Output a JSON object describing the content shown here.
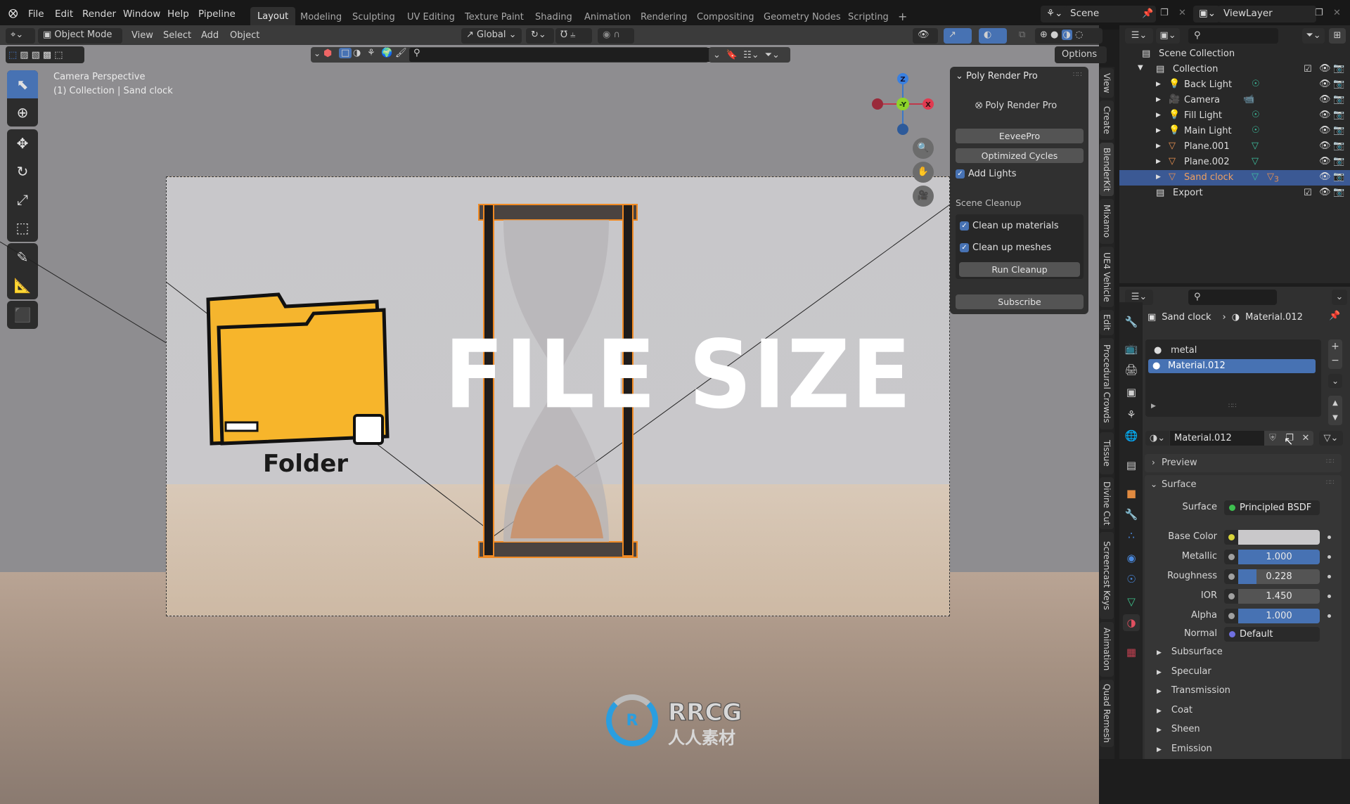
{
  "topbar": {
    "menus": [
      "File",
      "Edit",
      "Render",
      "Window",
      "Help",
      "Pipeline"
    ],
    "workspaces": [
      "Layout",
      "Modeling",
      "Sculpting",
      "UV Editing",
      "Texture Paint",
      "Shading",
      "Animation",
      "Rendering",
      "Compositing",
      "Geometry Nodes",
      "Scripting"
    ],
    "active_workspace": "Layout",
    "add_workspace": "+",
    "scene": "Scene",
    "view_layer": "ViewLayer"
  },
  "viewport_header": {
    "mode": "Object Mode",
    "menus": [
      "View",
      "Select",
      "Add",
      "Object"
    ],
    "orientation": "Global",
    "options": "Options"
  },
  "viewport": {
    "camera_label": "Camera Perspective",
    "collection_label": "(1) Collection | Sand clock",
    "overlay_title": "FILE SIZE",
    "folder_caption": "Folder",
    "watermark_top": "RRCG",
    "watermark_bottom": "人人素材",
    "gizmo": {
      "z": "Z",
      "y": "-Y",
      "x": "X"
    }
  },
  "poly_render_panel": {
    "title": "Poly Render Pro",
    "logo_text": "Poly Render Pro",
    "btn_eevee": "EeveePro",
    "btn_cycles": "Optimized Cycles",
    "add_lights": {
      "label": "Add Lights",
      "checked": true
    },
    "cleanup_heading": "Scene Cleanup",
    "clean_materials": {
      "label": "Clean up materials",
      "checked": true
    },
    "clean_meshes": {
      "label": "Clean up meshes",
      "checked": true
    },
    "btn_run_cleanup": "Run Cleanup",
    "btn_subscribe": "Subscribe"
  },
  "sidebar_tabs": [
    "View",
    "Create",
    "BlenderKit",
    "Mixamo",
    "UE4 Vehicle",
    "Edit",
    "Procedural Crowds",
    "Tissue",
    "Divine Cut",
    "Screencast Keys",
    "Animation",
    "Quad Remesh"
  ],
  "outliner": {
    "root": "Scene Collection",
    "collection": "Collection",
    "items": [
      {
        "name": "Back Light",
        "type": "light"
      },
      {
        "name": "Camera",
        "type": "camera"
      },
      {
        "name": "Fill Light",
        "type": "light"
      },
      {
        "name": "Main Light",
        "type": "light"
      },
      {
        "name": "Plane.001",
        "type": "mesh"
      },
      {
        "name": "Plane.002",
        "type": "mesh"
      },
      {
        "name": "Sand clock",
        "type": "mesh",
        "selected": true,
        "modifier_count": "3"
      }
    ],
    "export": "Export"
  },
  "properties": {
    "breadcrumb_object": "Sand clock",
    "breadcrumb_material": "Material.012",
    "slots": [
      {
        "name": "metal"
      },
      {
        "name": "Material.012",
        "selected": true
      }
    ],
    "material_name": "Material.012",
    "preview": "Preview",
    "surface_section": "Surface",
    "surface_label": "Surface",
    "surface_value": "Principled BSDF",
    "fields": [
      {
        "label": "Base Color",
        "value": "",
        "fill": 0,
        "socket": "#d8d43a"
      },
      {
        "label": "Metallic",
        "value": "1.000",
        "fill": 1.0,
        "socket": "#a0a0a0"
      },
      {
        "label": "Roughness",
        "value": "0.228",
        "fill": 0.228,
        "socket": "#a0a0a0"
      },
      {
        "label": "IOR",
        "value": "1.450",
        "fill": 0,
        "socket": "#a0a0a0"
      },
      {
        "label": "Alpha",
        "value": "1.000",
        "fill": 1.0,
        "socket": "#a0a0a0"
      }
    ],
    "normal_label": "Normal",
    "normal_value": "Default",
    "subpanels": [
      "Subsurface",
      "Specular",
      "Transmission",
      "Coat",
      "Sheen",
      "Emission"
    ]
  },
  "colors": {
    "accent": "#4772b3",
    "selection": "#3b5994",
    "orange": "#f08a24"
  }
}
